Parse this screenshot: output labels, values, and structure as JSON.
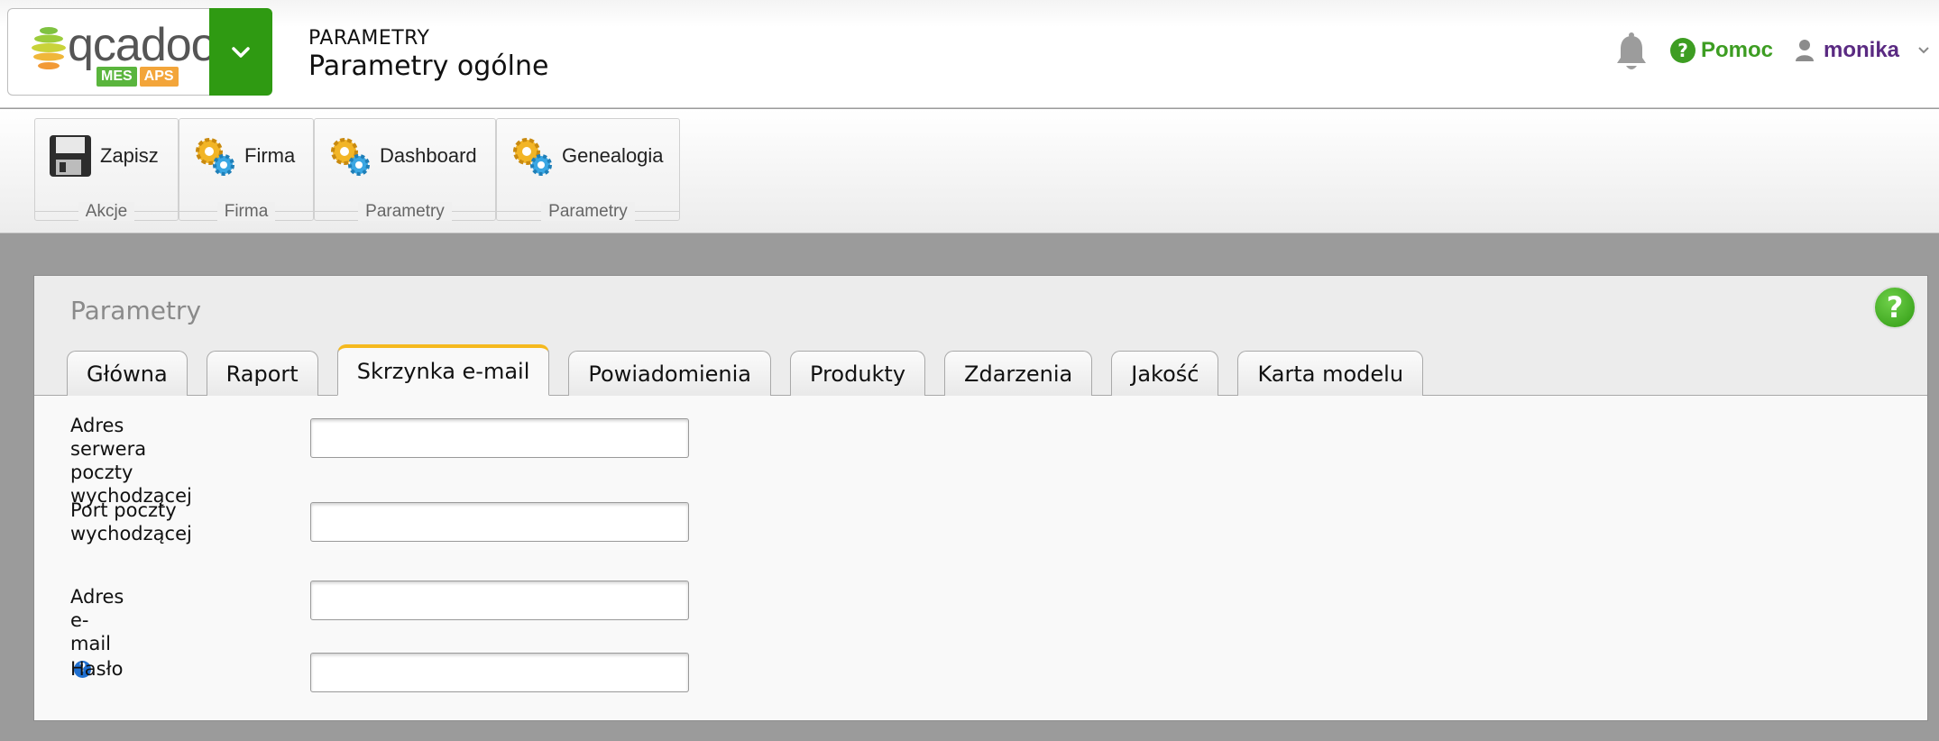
{
  "brand": {
    "logo_text": "qcadoo",
    "badge_mes": "MES",
    "badge_aps": "APS",
    "colors": {
      "green": "#2f9a12",
      "mes": "#5ab53d",
      "aps": "#f3a53a"
    }
  },
  "header": {
    "category": "PARAMETRY",
    "title": "Parametry ogólne",
    "help_label": "Pomoc",
    "user_name": "monika",
    "help_color": "#3d9d22",
    "user_color": "#5a2a82"
  },
  "ribbon": {
    "groups": [
      {
        "button": "Zapisz",
        "label": "Akcje",
        "icon": "save-icon"
      },
      {
        "button": "Firma",
        "label": "Firma",
        "icon": "gears-icon"
      },
      {
        "button": "Dashboard",
        "label": "Parametry",
        "icon": "gears-icon"
      },
      {
        "button": "Genealogia",
        "label": "Parametry",
        "icon": "gears-icon"
      }
    ]
  },
  "panel": {
    "title": "Parametry",
    "tabs": [
      "Główna",
      "Raport",
      "Skrzynka e-mail",
      "Powiadomienia",
      "Produkty",
      "Zdarzenia",
      "Jakość",
      "Karta modelu"
    ],
    "active_tab_index": 2,
    "active_tab_color": "#f5b91e"
  },
  "form": {
    "smtp_host": {
      "label_lines": [
        "Adres serwera",
        "poczty",
        "wychodzącej"
      ],
      "value": ""
    },
    "smtp_port": {
      "label_lines": [
        "Port poczty",
        "wychodzącej"
      ],
      "value": ""
    },
    "email": {
      "label": "Adres e-mail",
      "value": ""
    },
    "password": {
      "label": "Hasło",
      "value": ""
    }
  }
}
